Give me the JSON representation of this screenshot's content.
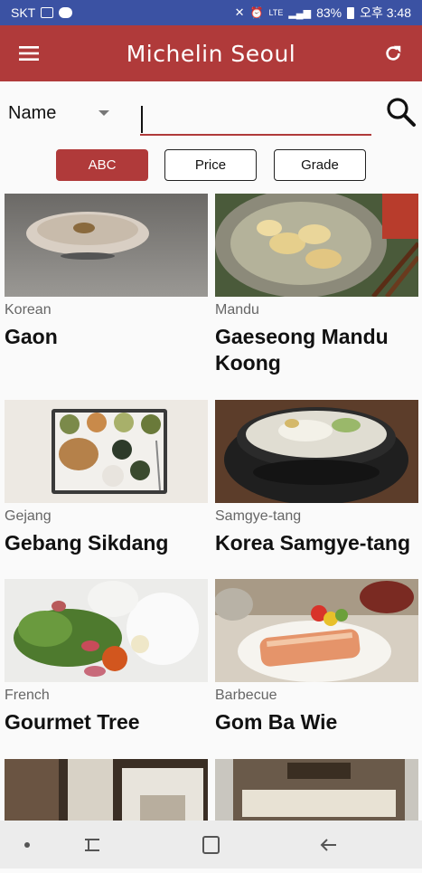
{
  "statusbar": {
    "carrier": "SKT",
    "network": "LTE",
    "battery": "83%",
    "time": "오후 3:48"
  },
  "appbar": {
    "title": "Michelin Seoul",
    "menu_icon": "hamburger-menu-icon",
    "refresh_icon": "refresh-icon"
  },
  "search": {
    "field_selected": "Name",
    "value": "",
    "placeholder": "",
    "search_icon": "search-icon"
  },
  "sort": {
    "buttons": [
      {
        "label": "ABC",
        "active": true
      },
      {
        "label": "Price",
        "active": false
      },
      {
        "label": "Grade",
        "active": false
      }
    ]
  },
  "restaurants": [
    {
      "category": "Korean",
      "name": "Gaon"
    },
    {
      "category": "Mandu",
      "name": "Gaeseong Mandu Koong"
    },
    {
      "category": "Gejang",
      "name": "Gebang Sikdang"
    },
    {
      "category": "Samgye-tang",
      "name": "Korea Samgye-tang"
    },
    {
      "category": "French",
      "name": "Gourmet Tree"
    },
    {
      "category": "Barbecue",
      "name": "Gom Ba Wie"
    },
    {
      "category": "",
      "name": ""
    },
    {
      "category": "",
      "name": ""
    }
  ],
  "colors": {
    "accent": "#b03a3a",
    "statusbar": "#3b52a3"
  }
}
